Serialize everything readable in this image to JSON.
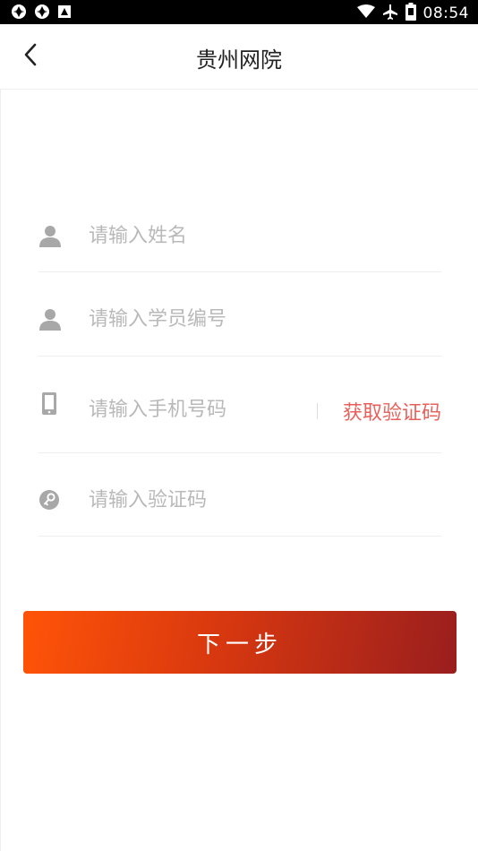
{
  "status_bar": {
    "time": "08:54",
    "left_icons": [
      "aperture-icon",
      "aperture-icon",
      "image-icon"
    ],
    "right_icons": [
      "wifi-icon",
      "airplane-icon",
      "battery-icon"
    ]
  },
  "app_bar": {
    "title": "贵州网院",
    "back_icon": "chevron-left-icon"
  },
  "form": {
    "name_placeholder": "请输入姓名",
    "student_id_placeholder": "请输入学员编号",
    "phone_placeholder": "请输入手机号码",
    "get_code_label": "获取验证码",
    "code_placeholder": "请输入验证码"
  },
  "next_button": {
    "label": "下一步"
  },
  "colors": {
    "accent_text": "#e8615a",
    "button_gradient_start": "#ff5408",
    "button_gradient_end": "#9a1e1e",
    "placeholder": "#b9b9b9",
    "icon_gray": "#a8a8a8"
  }
}
